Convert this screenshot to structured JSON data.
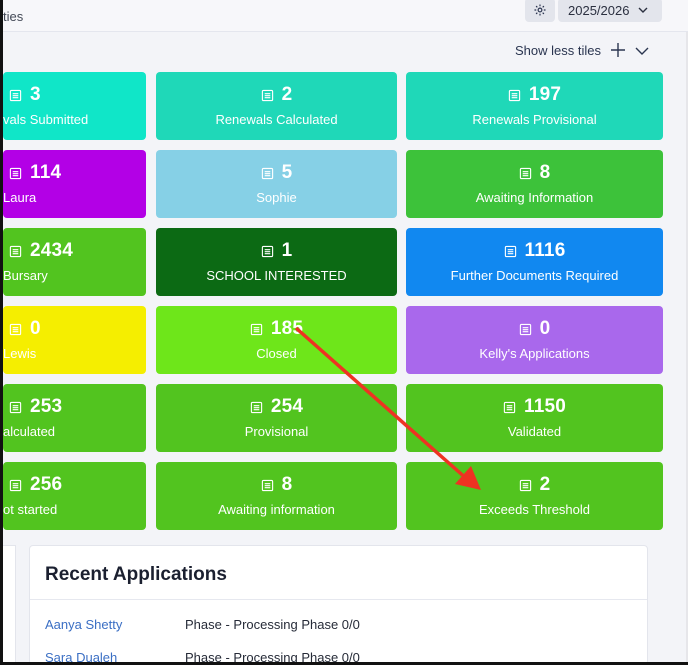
{
  "topbar": {
    "breadcrumb": "ties",
    "year": "2025/2026"
  },
  "tiles_toggle": {
    "label": "Show less tiles"
  },
  "tiles": [
    {
      "count": "3",
      "label": "vals Submitted",
      "color": "#10e6c8"
    },
    {
      "count": "2",
      "label": "Renewals Calculated",
      "color": "#1fd8b8"
    },
    {
      "count": "197",
      "label": "Renewals Provisional",
      "color": "#1fd8b8"
    },
    {
      "count": "114",
      "label": "Laura",
      "color": "#b300e6"
    },
    {
      "count": "5",
      "label": "Sophie",
      "color": "#86d0e6"
    },
    {
      "count": "8",
      "label": "Awaiting Information",
      "color": "#3dc23a"
    },
    {
      "count": "2434",
      "label": "Bursary",
      "color": "#52c41f"
    },
    {
      "count": "1",
      "label": "SCHOOL INTERESTED",
      "color": "#0c6a14"
    },
    {
      "count": "1116",
      "label": "Further Documents Required",
      "color": "#1188f0"
    },
    {
      "count": "0",
      "label": "Lewis",
      "color": "#f5ee00"
    },
    {
      "count": "185",
      "label": "Closed",
      "color": "#6ee61a"
    },
    {
      "count": "0",
      "label": "Kelly's Applications",
      "color": "#a968ec"
    },
    {
      "count": "253",
      "label": "alculated",
      "color": "#52c41f"
    },
    {
      "count": "254",
      "label": "Provisional",
      "color": "#52c41f"
    },
    {
      "count": "1150",
      "label": "Validated",
      "color": "#52c41f"
    },
    {
      "count": "256",
      "label": "ot started",
      "color": "#52c41f"
    },
    {
      "count": "8",
      "label": "Awaiting information",
      "color": "#52c41f"
    },
    {
      "count": "2",
      "label": "Exceeds Threshold",
      "color": "#52c41f"
    }
  ],
  "recent": {
    "title": "Recent Applications",
    "rows": [
      {
        "name": "Aanya Shetty",
        "phase": "Phase - Processing Phase 0/0"
      },
      {
        "name": "Sara Dualeh",
        "phase": "Phase - Processing Phase 0/0"
      }
    ]
  },
  "annotation": {
    "color": "#ee3322"
  }
}
